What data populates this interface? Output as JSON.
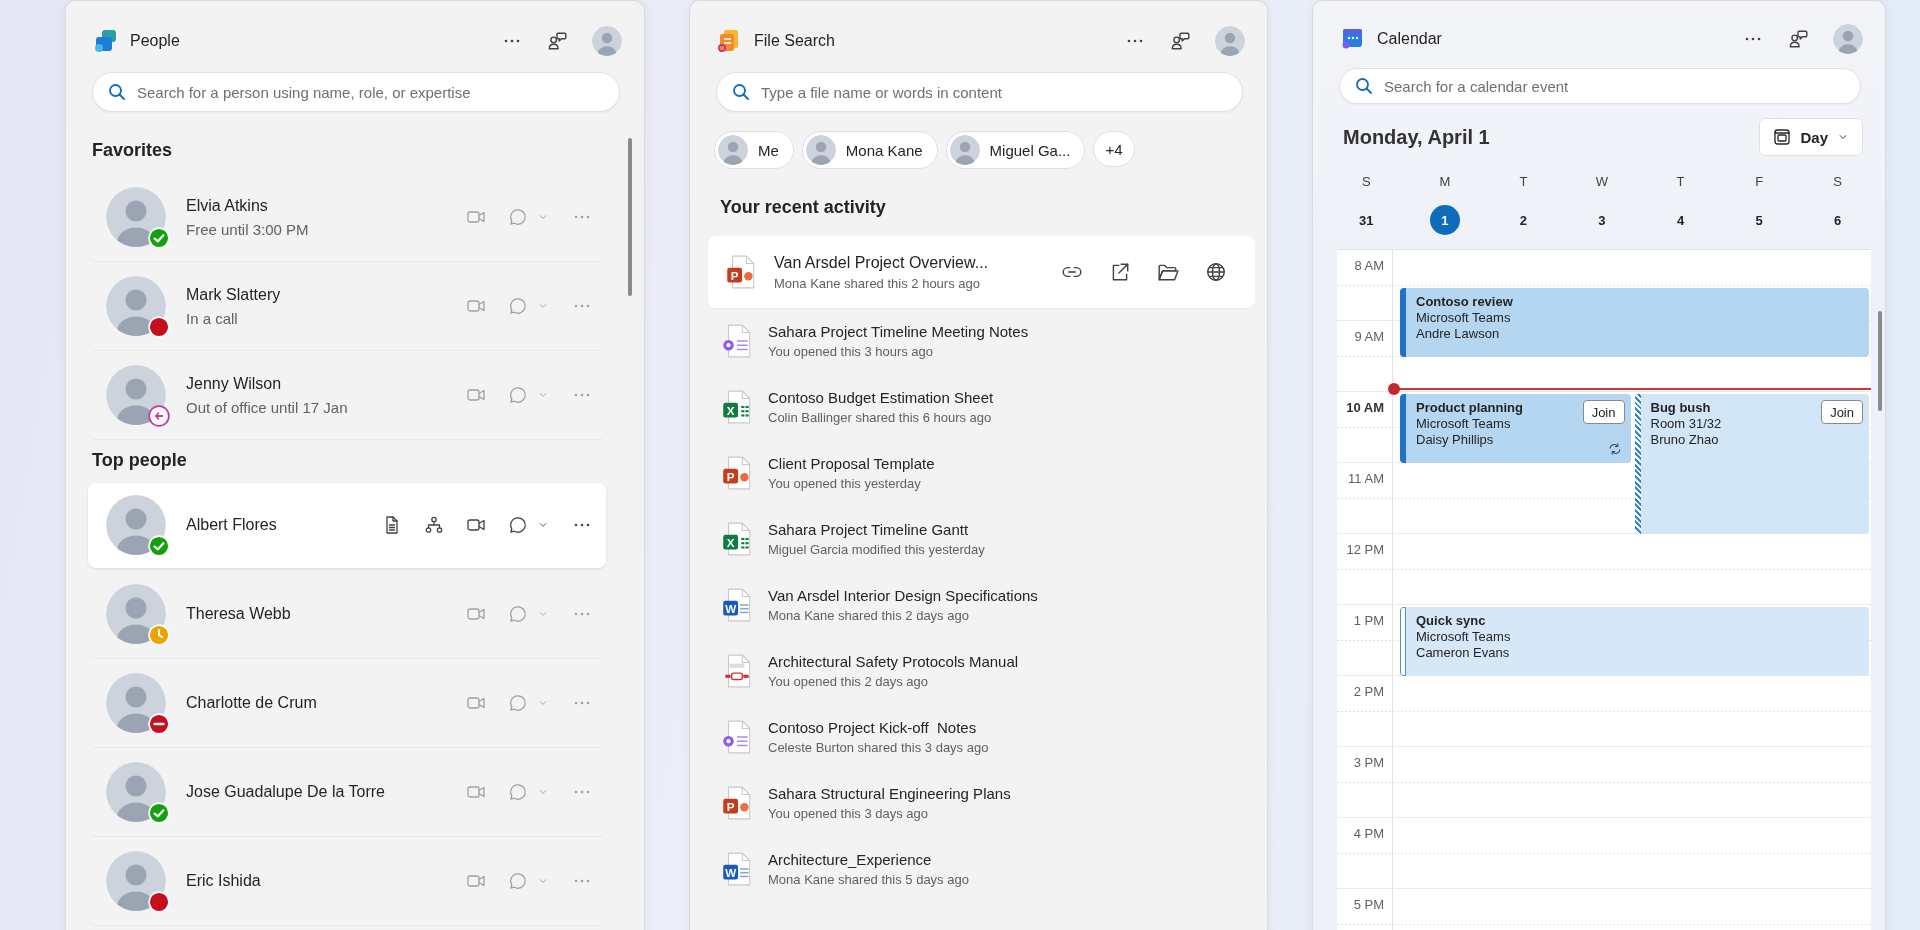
{
  "people": {
    "title": "People",
    "search": {
      "placeholder": "Search for a person using name, role, or expertise"
    },
    "sections": [
      {
        "heading": "Favorites",
        "contacts": [
          {
            "name": "Elvia Atkins",
            "status": "Free until 3:00 PM",
            "kind": "available",
            "selected": false
          },
          {
            "name": "Mark Slattery",
            "status": "In a call",
            "kind": "busy",
            "selected": false
          },
          {
            "name": "Jenny Wilson",
            "status": "Out of office until 17 Jan",
            "kind": "out-of-office",
            "selected": false
          }
        ]
      },
      {
        "heading": "Top people",
        "contacts": [
          {
            "name": "Albert Flores",
            "kind": "available",
            "selected": true
          },
          {
            "name": "Theresa Webb",
            "kind": "away",
            "selected": false
          },
          {
            "name": "Charlotte de Crum",
            "kind": "do-not-disturb",
            "selected": false
          },
          {
            "name": "Jose Guadalupe De la Torre",
            "kind": "available",
            "selected": false
          },
          {
            "name": "Eric Ishida",
            "kind": "busy",
            "selected": false
          }
        ]
      }
    ]
  },
  "file_search": {
    "title": "File Search",
    "search": {
      "placeholder": "Type a file name or words in content"
    },
    "filters": [
      {
        "label": "Me",
        "kind": "person"
      },
      {
        "label": "Mona Kane",
        "kind": "person"
      },
      {
        "label": "Miguel Ga...",
        "kind": "person"
      },
      {
        "label": "+4",
        "kind": "more"
      }
    ],
    "heading": "Your recent activity",
    "files": [
      {
        "name": "Van Arsdel Project Overview...",
        "detail": "Mona Kane shared this 2 hours ago",
        "kind": "powerpoint",
        "badge": "P",
        "selected": true
      },
      {
        "name": "Sahara Project Timeline Meeting Notes",
        "detail": "You opened this 3 hours ago",
        "kind": "loop",
        "selected": false
      },
      {
        "name": "Contoso Budget Estimation Sheet",
        "detail": "Colin Ballinger shared this 6 hours ago",
        "kind": "excel",
        "badge": "X",
        "selected": false
      },
      {
        "name": "Client Proposal Template",
        "detail": "You opened this yesterday",
        "kind": "powerpoint",
        "badge": "P",
        "selected": false
      },
      {
        "name": "Sahara Project Timeline Gantt",
        "detail": "Miguel Garcia modified this yesterday",
        "kind": "excel",
        "badge": "X",
        "selected": false
      },
      {
        "name": "Van Arsdel Interior Design Specifications",
        "detail": "Mona Kane shared this 2 days ago",
        "kind": "word",
        "badge": "W",
        "selected": false
      },
      {
        "name": "Architectural Safety Protocols Manual",
        "detail": "You opened this 2 days ago",
        "kind": "pdf",
        "selected": false
      },
      {
        "name": "Contoso Project Kick-off  Notes",
        "detail": "Celeste Burton shared this 3 days ago",
        "kind": "loop",
        "selected": false
      },
      {
        "name": "Sahara Structural Engineering Plans",
        "detail": "You opened this 3 days ago",
        "kind": "powerpoint",
        "badge": "P",
        "selected": false
      },
      {
        "name": "Architecture_Experience",
        "detail": "Mona Kane shared this 5 days ago",
        "kind": "word",
        "badge": "W",
        "selected": false
      }
    ]
  },
  "calendar": {
    "title": "Calendar",
    "search": {
      "placeholder": "Search for a calendar event"
    },
    "date_title": "Monday, April 1",
    "view": "Day",
    "days": [
      {
        "letter": "S",
        "date": "31",
        "selected": false
      },
      {
        "letter": "M",
        "date": "1",
        "selected": true
      },
      {
        "letter": "T",
        "date": "2",
        "selected": false
      },
      {
        "letter": "W",
        "date": "3",
        "selected": false
      },
      {
        "letter": "T",
        "date": "4",
        "selected": false
      },
      {
        "letter": "F",
        "date": "5",
        "selected": false
      },
      {
        "letter": "S",
        "date": "6",
        "selected": false
      }
    ],
    "hours": [
      "8 AM",
      "9 AM",
      "10 AM",
      "11 AM",
      "12 PM",
      "1 PM",
      "2 PM",
      "3 PM",
      "4 PM",
      "5 PM"
    ],
    "events": [
      {
        "title": "Contoso review",
        "location": "Microsoft Teams",
        "organizer": "Andre Lawson",
        "kind": "busy",
        "recurring": false
      },
      {
        "title": "Product planning",
        "location": "Microsoft Teams",
        "organizer": "Daisy Phillips",
        "kind": "busy",
        "action": "Join",
        "recurring": true
      },
      {
        "title": "Bug bush",
        "location": "Room 31/32",
        "organizer": "Bruno Zhao",
        "kind": "tentative",
        "action": "Join",
        "recurring": false
      },
      {
        "title": "Quick sync",
        "location": "Microsoft Teams",
        "organizer": "Cameron Evans",
        "kind": "free",
        "recurring": false
      }
    ]
  }
}
